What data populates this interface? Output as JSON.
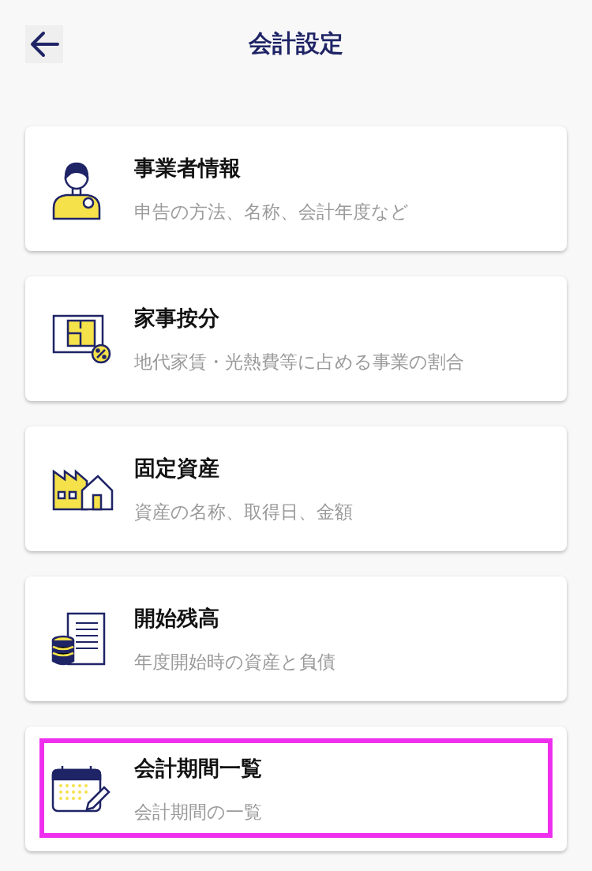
{
  "header": {
    "title": "会計設定"
  },
  "items": [
    {
      "kind": "person",
      "title": "事業者情報",
      "subtitle": "申告の方法、名称、会計年度など",
      "highlighted": false
    },
    {
      "kind": "floorplan",
      "title": "家事按分",
      "subtitle": "地代家賃・光熱費等に占める事業の割合",
      "highlighted": false
    },
    {
      "kind": "buildings",
      "title": "固定資産",
      "subtitle": "資産の名称、取得日、金額",
      "highlighted": false
    },
    {
      "kind": "ledger",
      "title": "開始残高",
      "subtitle": "年度開始時の資産と負債",
      "highlighted": false
    },
    {
      "kind": "calendar",
      "title": "会計期間一覧",
      "subtitle": "会計期間の一覧",
      "highlighted": true
    }
  ]
}
